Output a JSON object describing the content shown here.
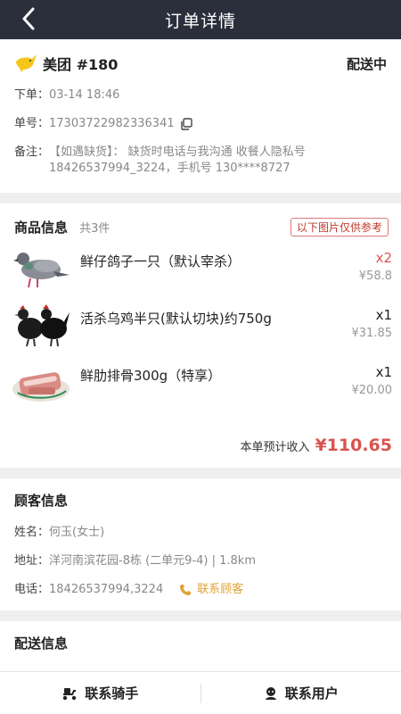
{
  "header": {
    "title": "订单详情"
  },
  "order": {
    "platform": "美团 #180",
    "status": "配送中",
    "time_label": "下单：",
    "time_value": "03-14 18:46",
    "no_label": "单号：",
    "no_value": "17303722982336341",
    "remark_label": "备注：",
    "remark_value": "【如遇缺货】： 缺货时电话与我沟通 收餐人隐私号 18426537994_3224，手机号 130****8727"
  },
  "goods": {
    "title": "商品信息",
    "count": "共3件",
    "ref_badge": "以下图片仅供参考",
    "items": [
      {
        "name": "鲜仔鸽子一只（默认宰杀）",
        "qty": "x2",
        "price": "¥58.8",
        "icon": "pigeon-image"
      },
      {
        "name": "活杀乌鸡半只(默认切块)约750g",
        "qty": "x1",
        "price": "¥31.85",
        "icon": "black-chicken-image"
      },
      {
        "name": "鲜肋排骨300g（特享）",
        "qty": "x1",
        "price": "¥20.00",
        "icon": "pork-ribs-image"
      }
    ],
    "income_label": "本单预计收入",
    "income_value": "¥110.65"
  },
  "customer": {
    "title": "顾客信息",
    "name_label": "姓名：",
    "name_value": "何玉(女士)",
    "addr_label": "地址：",
    "addr_value": "洋河南滨花园-8栋 (二单元9-4) | 1.8km",
    "phone_label": "电话：",
    "phone_value": "18426537994,3224",
    "contact_label": "联系顾客"
  },
  "delivery": {
    "title": "配送信息"
  },
  "bottom": {
    "rider_label": "联系骑手",
    "user_label": "联系用户"
  },
  "colors": {
    "header_bg": "#2b2f3b",
    "accent_red": "#d9534f",
    "accent_orange": "#e0a23c"
  }
}
